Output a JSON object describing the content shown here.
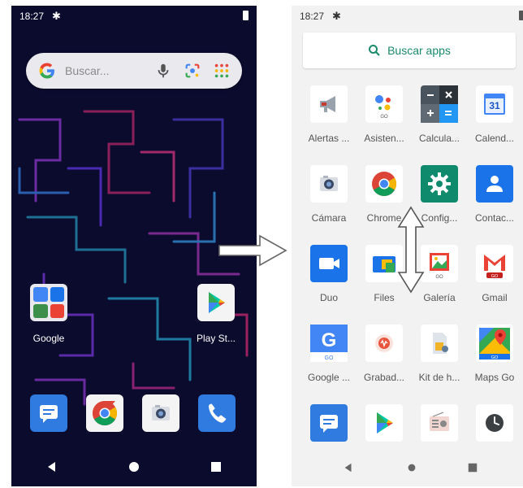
{
  "left_screen": {
    "status_bar": {
      "time": "18:27"
    },
    "search_bar": {
      "placeholder": "Buscar..."
    },
    "home_apps": [
      {
        "label": "Google"
      },
      {
        "label": "Play St..."
      }
    ],
    "dock": [
      "messages-icon",
      "chrome-icon",
      "camera-icon",
      "phone-icon"
    ]
  },
  "right_screen": {
    "status_bar": {
      "time": "18:27"
    },
    "search_apps": {
      "label": "Buscar apps"
    },
    "apps": [
      {
        "label": "Alertas ..."
      },
      {
        "label": "Asisten..."
      },
      {
        "label": "Calcula..."
      },
      {
        "label": "Calend..."
      },
      {
        "label": "Cámara"
      },
      {
        "label": "Chrome"
      },
      {
        "label": "Config..."
      },
      {
        "label": "Contac..."
      },
      {
        "label": "Duo"
      },
      {
        "label": "Files"
      },
      {
        "label": "Galería"
      },
      {
        "label": "Gmail"
      },
      {
        "label": "Google ..."
      },
      {
        "label": "Grabad..."
      },
      {
        "label": "Kit de h..."
      },
      {
        "label": "Maps Go"
      }
    ],
    "calendar_day": "31"
  },
  "colors": {
    "wallpaper": "#0b0b2e",
    "accent_green": "#1a8a6a",
    "drawer_bg": "#f2f2f2"
  }
}
